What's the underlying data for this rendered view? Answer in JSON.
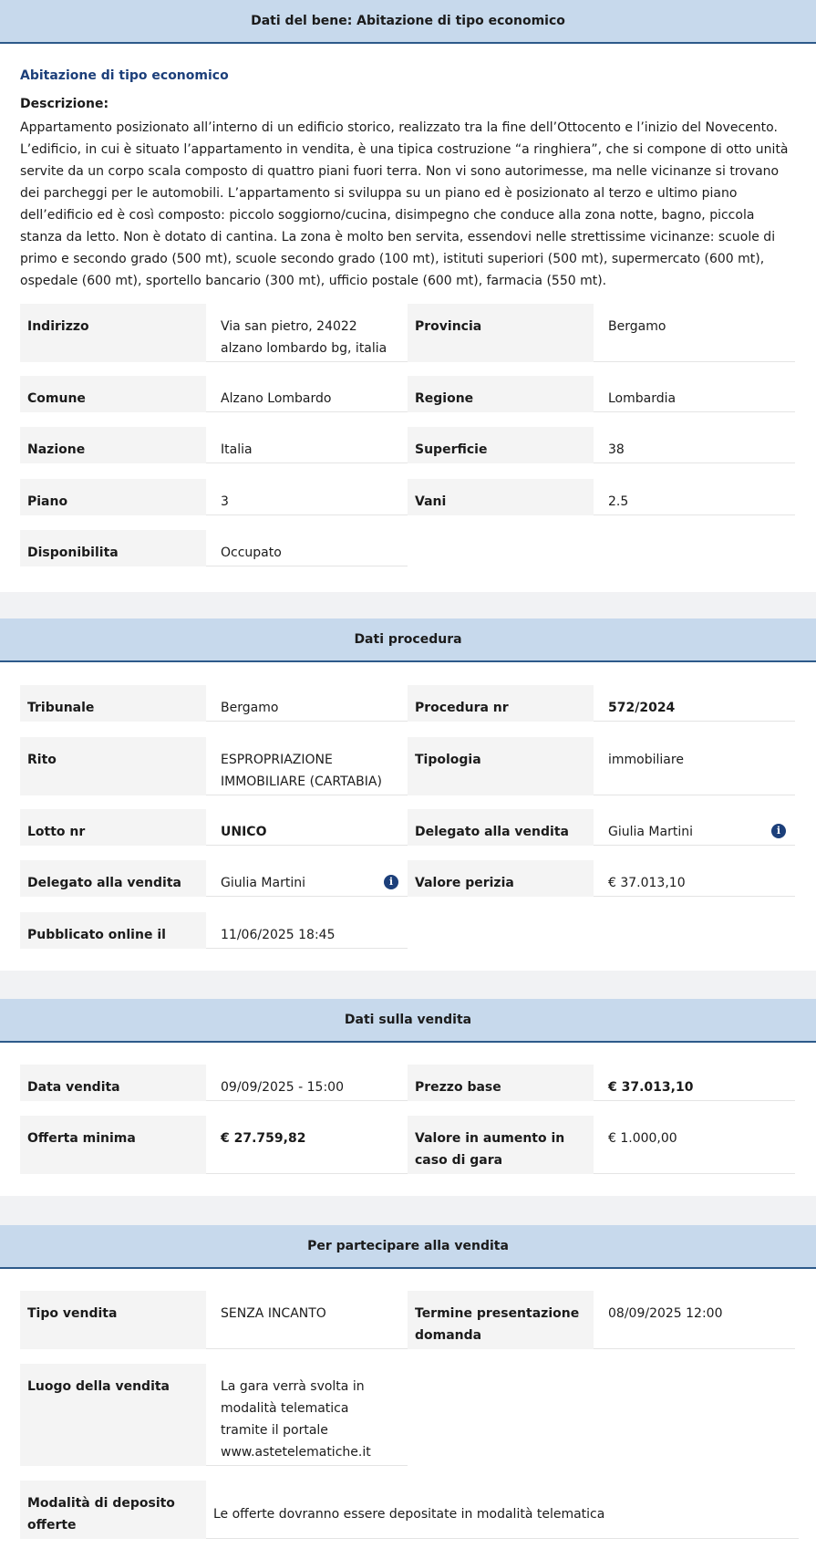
{
  "bene": {
    "header": "Dati del bene: Abitazione di tipo economico",
    "subtitle": "Abitazione di tipo economico",
    "desc_label": "Descrizione:",
    "description": "Appartamento posizionato all’interno di un edificio storico, realizzato tra la fine dell’Ottocento e l’inizio del Novecento. L’edificio, in cui è situato l’appartamento in vendita, è una tipica costruzione “a ringhiera”, che si compone di otto unità servite da un corpo scala composto di quattro piani fuori terra. Non vi sono autorimesse, ma nelle vicinanze si trovano dei parcheggi per le automobili. L’appartamento si sviluppa su un piano ed è posizionato al terzo e ultimo piano dell’edificio ed è così composto: piccolo soggiorno/cucina, disimpegno che conduce alla zona notte, bagno, piccola stanza da letto. Non è dotato di cantina. La zona è molto ben servita, essendovi nelle strettissime vicinanze: scuole di primo e secondo grado (500 mt), scuole secondo grado (100 mt), istituti superiori (500 mt), supermercato (600 mt), ospedale (600 mt), sportello bancario (300 mt), ufficio postale (600 mt), farmacia (550 mt).",
    "fields": {
      "indirizzo_label": "Indirizzo",
      "indirizzo_value": "Via san pietro, 24022 alzano lombardo bg, italia",
      "provincia_label": "Provincia",
      "provincia_value": "Bergamo",
      "comune_label": "Comune",
      "comune_value": "Alzano Lombardo",
      "regione_label": "Regione",
      "regione_value": "Lombardia",
      "nazione_label": "Nazione",
      "nazione_value": "Italia",
      "superficie_label": "Superficie",
      "superficie_value": "38",
      "piano_label": "Piano",
      "piano_value": "3",
      "vani_label": "Vani",
      "vani_value": "2.5",
      "disponibilita_label": "Disponibilita",
      "disponibilita_value": "Occupato"
    }
  },
  "procedura": {
    "header": "Dati procedura",
    "fields": {
      "tribunale_label": "Tribunale",
      "tribunale_value": "Bergamo",
      "procedura_label": "Procedura nr",
      "procedura_value": "572/2024",
      "rito_label": "Rito",
      "rito_value": "ESPROPRIAZIONE IMMOBILIARE (CARTABIA)",
      "tipologia_label": "Tipologia",
      "tipologia_value": "immobiliare",
      "lotto_label": "Lotto nr",
      "lotto_value": "UNICO",
      "delegato1_label": "Delegato alla vendita",
      "delegato1_value": "Giulia Martini",
      "delegato2_label": "Delegato alla vendita",
      "delegato2_value": "Giulia Martini",
      "perizia_label": "Valore perizia",
      "perizia_value": "€ 37.013,10",
      "pubblicato_label": "Pubblicato online il",
      "pubblicato_value": "11/06/2025 18:45"
    }
  },
  "vendita": {
    "header": "Dati sulla vendita",
    "fields": {
      "data_label": "Data vendita",
      "data_value": "09/09/2025 - 15:00",
      "prezzo_label": "Prezzo base",
      "prezzo_value": "€ 37.013,10",
      "offerta_label": "Offerta minima",
      "offerta_value": "€ 27.759,82",
      "aumento_label": "Valore in aumento in caso di gara",
      "aumento_value": "€ 1.000,00"
    }
  },
  "partecipare": {
    "header": "Per partecipare alla vendita",
    "fields": {
      "tipo_label": "Tipo vendita",
      "tipo_value": "SENZA INCANTO",
      "termine_label": "Termine presentazione domanda",
      "termine_value": "08/09/2025 12:00",
      "luogo_label": "Luogo della vendita",
      "luogo_value": "La gara verrà svolta in modalità telematica tramite il portale www.astetelematiche.it",
      "deposito_label": "Modalità di deposito offerte",
      "deposito_value": "Le offerte dovranno essere depositate in modalità telematica"
    }
  },
  "icons": {
    "info": "info-icon"
  },
  "colors": {
    "header_bg": "#c7d9ec",
    "accent": "#1c3f7a",
    "label_bg": "#f4f4f4"
  }
}
